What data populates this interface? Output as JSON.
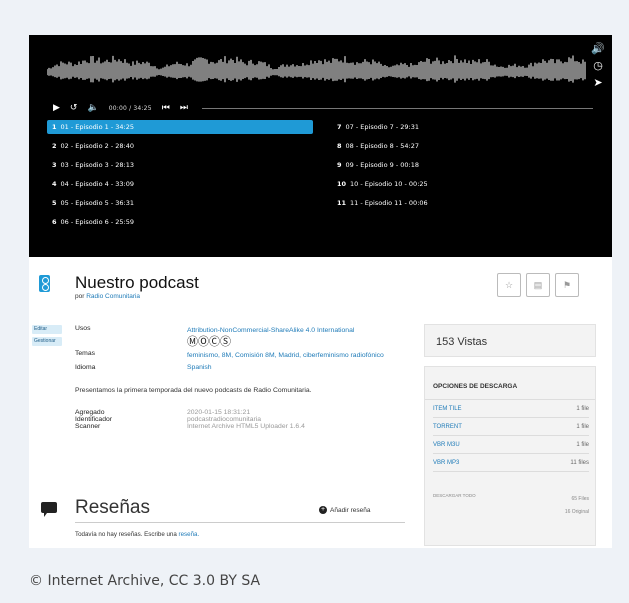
{
  "player": {
    "time": "00:00 / 34:25",
    "tracks_left": [
      {
        "num": "1",
        "label": "01 - Episodio 1 - 34:25",
        "active": true
      },
      {
        "num": "2",
        "label": "02 - Episodio 2 - 28:40",
        "active": false
      },
      {
        "num": "3",
        "label": "03 - Episodio 3 - 28:13",
        "active": false
      },
      {
        "num": "4",
        "label": "04 - Episodio 4 - 33:09",
        "active": false
      },
      {
        "num": "5",
        "label": "05 - Episodio 5 - 36:31",
        "active": false
      },
      {
        "num": "6",
        "label": "06 - Episodio 6 - 25:59",
        "active": false
      }
    ],
    "tracks_right": [
      {
        "num": "7",
        "label": "07 - Episodio 7 - 29:31"
      },
      {
        "num": "8",
        "label": "08 - Episodio 8 - 54:27"
      },
      {
        "num": "9",
        "label": "09 - Episodio 9 - 00:18"
      },
      {
        "num": "10",
        "label": "10 - Episodio 10 - 00:25"
      },
      {
        "num": "11",
        "label": "11 - Episodio 11 - 00:06"
      }
    ]
  },
  "item": {
    "title": "Nuestro podcast",
    "by_prefix": "por",
    "author": "Radio Comunitaria",
    "tag_edit": "Editar",
    "tag_manage": "Gestionar"
  },
  "meta": {
    "usage_label": "Usos",
    "usage_value": "Attribution-NonCommercial-ShareAlike 4.0 International",
    "topics_label": "Temas",
    "topics_value": "feminismo, 8M, Comisión 8M, Madrid, ciberfeminismo radiofónico",
    "language_label": "Idioma",
    "language_value": "Spanish",
    "description": "Presentamos la primera temporada del nuevo podcasts de Radio Comunitaria.",
    "added_label": "Agregado",
    "added_value": "2020-01-15 18:31:21",
    "identifier_label": "Identificador",
    "identifier_value": "podcastradiocomunitaria",
    "scanner_label": "Scanner",
    "scanner_value": "Internet Archive HTML5 Uploader 1.6.4"
  },
  "views": "153 Vistas",
  "downloads": {
    "heading": "OPCIONES DE DESCARGA",
    "rows": [
      {
        "name": "ITEM TILE",
        "count": "1 file"
      },
      {
        "name": "TORRENT",
        "count": "1 file"
      },
      {
        "name": "VBR M3U",
        "count": "1 file"
      },
      {
        "name": "VBR MP3",
        "count": "11 files"
      }
    ],
    "show_all": "DESCARGAR TODO",
    "total_files": "65 Files",
    "total_original": "16 Original"
  },
  "reviews": {
    "title": "Reseñas",
    "add": "Añadir reseña",
    "none_text": "Todavía no hay reseñas. Escribe una",
    "none_link": "reseña."
  },
  "caption": "© Internet Archive, CC 3.0 BY SA"
}
